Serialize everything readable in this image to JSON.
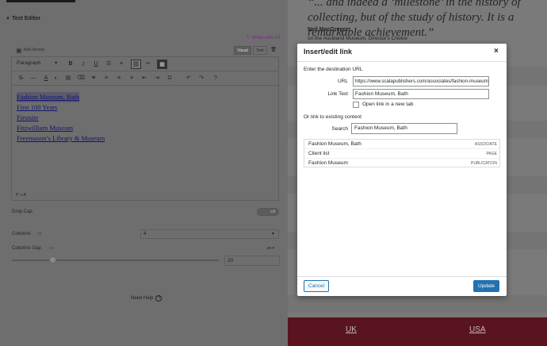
{
  "editor": {
    "section_title": "Text Editor",
    "write_ai": "Write with AI",
    "add_media": "Add Media",
    "tabs": {
      "visual": "Visual",
      "text": "Text"
    },
    "format_select": "Paragraph",
    "links": [
      "Fashion Museum, Bath",
      "First 100 Years",
      "Firstsite",
      "Fitzwilliam Museum",
      "Freemason’s Library & Museum"
    ],
    "path": "P » A",
    "drop_cap": {
      "label": "Drop Cap",
      "toggle": "Off"
    },
    "columns": {
      "label": "Columns",
      "value": "4"
    },
    "columns_gap": {
      "label": "Columns Gap",
      "unit": "px",
      "value": "20"
    },
    "need_help": "Need Help"
  },
  "page": {
    "quote": "“... and indeed a ‘milestone’ in the history of collecting, but of the study of history. It is a remarkable achievement.”",
    "author": "Neil MacGregor",
    "author_role": "on the Auckland Museum, Director's Choice",
    "footer_links": [
      "UK",
      "USA"
    ]
  },
  "dialog": {
    "title": "Insert/edit link",
    "prompt": "Enter the destination URL",
    "url_label": "URL",
    "url_value": "https://www.scalapublishers.com/associates/fashion-museum-bath/",
    "link_text_label": "Link Text",
    "link_text_value": "Fashion Museum, Bath",
    "new_tab_label": "Open link in a new tab",
    "existing_label": "Or link to existing content",
    "search_label": "Search",
    "search_value": "Fashion Museum, Bath",
    "results": [
      {
        "title": "Fashion Museum, Bath",
        "type": "Associate"
      },
      {
        "title": "Client list",
        "type": "Page"
      },
      {
        "title": "Fashion Museum",
        "type": "Publication"
      }
    ],
    "cancel": "Cancel",
    "update": "Update"
  }
}
